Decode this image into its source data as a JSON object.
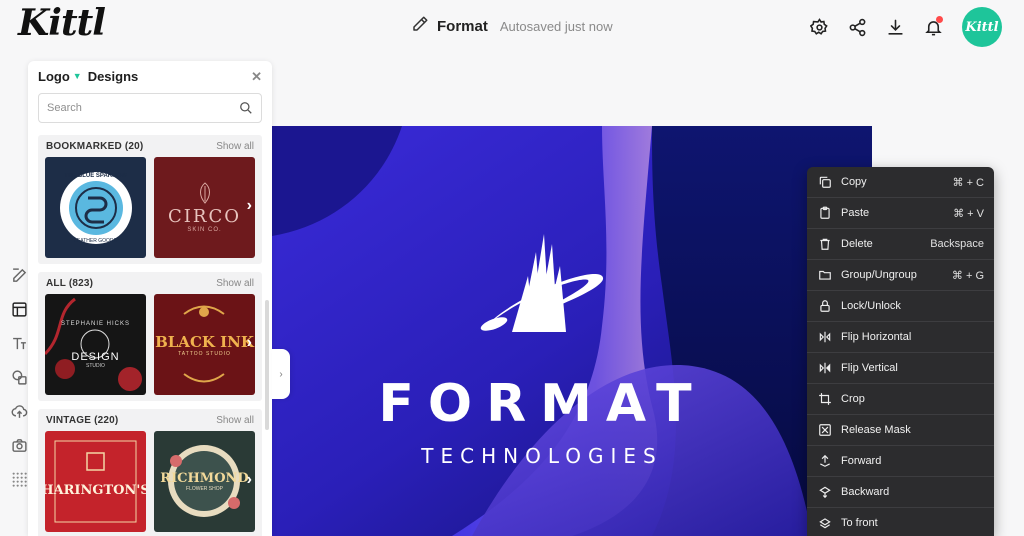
{
  "app": {
    "logo": "Kittl"
  },
  "header": {
    "doc_title": "Format",
    "autosave": "Autosaved just now",
    "avatar_text": "Kittl",
    "icons": [
      "settings-icon",
      "share-icon",
      "download-icon",
      "bell-icon"
    ]
  },
  "panel": {
    "category": "Logo",
    "title": "Designs",
    "search_placeholder": "Search",
    "show_all": "Show all",
    "sections": [
      {
        "title": "BOOKMARKED (20)",
        "items": [
          {
            "top": "THE BLUE SPARROW",
            "bottom": "LEATHER GOODS"
          },
          {
            "main": "CIRCO",
            "sub": "SKIN CO."
          }
        ]
      },
      {
        "title": "ALL (823)",
        "items": [
          {
            "main": "STEPHANIE HICKS",
            "sub": "DESIGN",
            "sub2": "STUDIO"
          },
          {
            "main": "BLACK INK",
            "sub": "TATTOO STUDIO"
          }
        ]
      },
      {
        "title": "VINTAGE (220)",
        "items": [
          {
            "main": "HARINGTON'S"
          },
          {
            "main": "RICHMOND",
            "sub": "FLOWER SHOP"
          }
        ]
      }
    ]
  },
  "canvas": {
    "title": "FORMAT",
    "subtitle": "TECHNOLOGIES"
  },
  "context_menu": [
    {
      "label": "Copy",
      "shortcut": "⌘ + C",
      "icon": "copy-icon"
    },
    {
      "label": "Paste",
      "shortcut": "⌘ + V",
      "icon": "paste-icon"
    },
    {
      "label": "Delete",
      "shortcut": "Backspace",
      "icon": "trash-icon"
    },
    {
      "label": "Group/Ungroup",
      "shortcut": "⌘ + G",
      "icon": "folder-icon"
    },
    {
      "label": "Lock/Unlock",
      "shortcut": "",
      "icon": "lock-icon"
    },
    {
      "label": "Flip Horizontal",
      "shortcut": "",
      "icon": "flip-horizontal-icon"
    },
    {
      "label": "Flip Vertical",
      "shortcut": "",
      "icon": "flip-vertical-icon"
    },
    {
      "label": "Crop",
      "shortcut": "",
      "icon": "crop-icon"
    },
    {
      "label": "Release Mask",
      "shortcut": "",
      "icon": "release-mask-icon"
    },
    {
      "label": "Forward",
      "shortcut": "",
      "icon": "forward-icon"
    },
    {
      "label": "Backward",
      "shortcut": "",
      "icon": "backward-icon"
    },
    {
      "label": "To front",
      "shortcut": "",
      "icon": "to-front-icon"
    }
  ],
  "rail": [
    "edit-icon",
    "layout-icon",
    "text-icon",
    "shapes-icon",
    "upload-icon",
    "camera-icon",
    "grid-icon"
  ],
  "colors": {
    "accent": "#1ec59a",
    "artboard": "#221a8f",
    "menu_bg": "#2c2c2e"
  }
}
